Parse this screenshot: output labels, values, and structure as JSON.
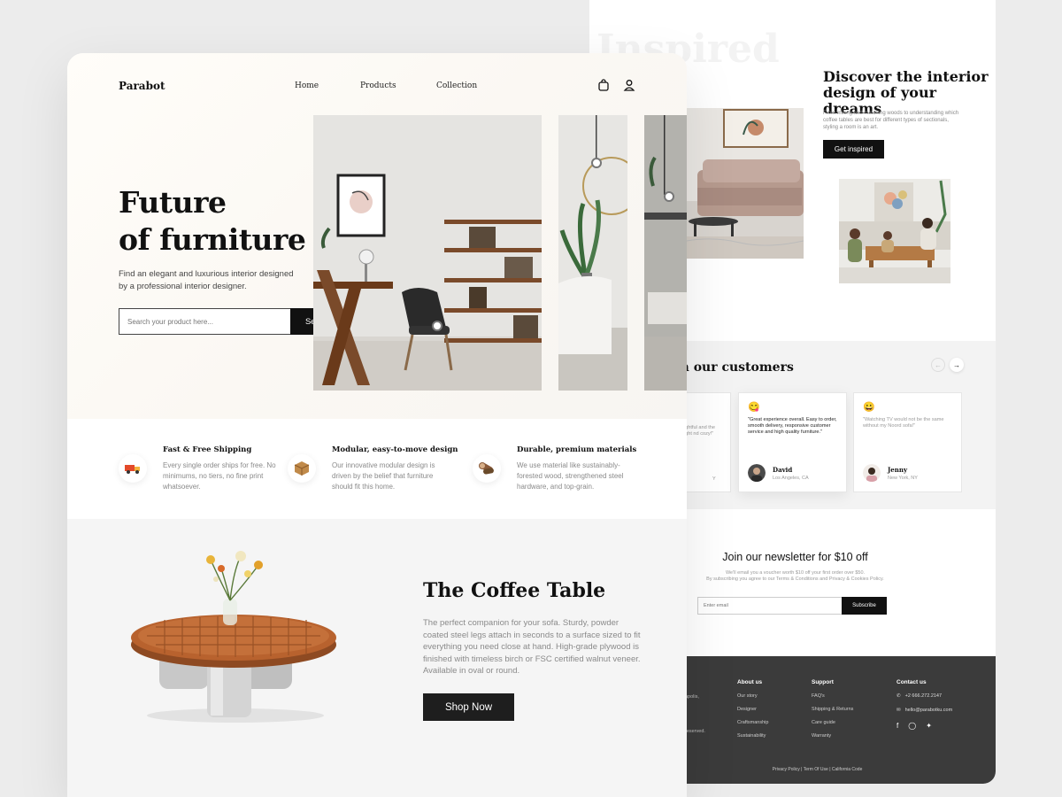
{
  "back": {
    "ghost_text": "Inspired",
    "discover": {
      "title_line1": "Discover the interior",
      "title_line2": "design of your dreams",
      "text": "From mixing and matching woods to understanding which coffee tables are best for different types of sectionals, styling a room is an art.",
      "button": "Get inspired"
    },
    "customers": {
      "title": "m our customers",
      "cards": [
        {
          "quote": "ughtful and the right nd cozy!\"",
          "name": "",
          "location": "Y"
        },
        {
          "quote": "\"Great experience overall. Easy to order, smooth delivery, responsive customer service and high quality furniture.\"",
          "name": "David",
          "location": "Los Angeles, CA"
        },
        {
          "quote": "\"Watching TV would not be the same without my Noord sofa!\"",
          "name": "Jenny",
          "location": "New York, NY"
        }
      ]
    },
    "newsletter": {
      "title": "Join our newsletter for $10 off",
      "sub1": "We'll email you a voucher worth $10 off your first order over $50.",
      "sub2": "By subscribing you agree to our Terms & Conditions and Privacy & Cookies Policy.",
      "placeholder": "Enter email",
      "button": "Subscribe"
    },
    "footer": {
      "partial1": "apolis,",
      "partial2": "reserved.",
      "about": {
        "title": "About us",
        "links": [
          "Our story",
          "Designer",
          "Craftsmanship",
          "Sustainability"
        ]
      },
      "support": {
        "title": "Support",
        "links": [
          "FAQ's",
          "Shipping & Returns",
          "Care guide",
          "Warranty"
        ]
      },
      "contact": {
        "title": "Contact us",
        "phone": "+2 666.272.2147",
        "email": "hello@parabotku.com"
      },
      "legal": "Privacy Policy | Term Of Use | California Code"
    }
  },
  "front": {
    "logo": "Parabot",
    "nav": [
      "Home",
      "Products",
      "Collection"
    ],
    "hero": {
      "title_line1": "Future",
      "title_line2": "of furniture",
      "subtitle": "Find an elegant and luxurious interior designed by a professional interior designer.",
      "search_placeholder": "Search your product here...",
      "search_button": "Search"
    },
    "features": [
      {
        "title": "Fast & Free Shipping",
        "text": "Every single order ships for free. No minimums, no tiers, no fine print whatsoever."
      },
      {
        "title": "Modular, easy-to-move design",
        "text": "Our innovative modular design is driven by the belief that furniture should fit this home."
      },
      {
        "title": "Durable, premium materials",
        "text": "We use material like sustainably-forested wood, strengthened steel hardware, and top-grain."
      }
    ],
    "product": {
      "title": "The Coffee Table",
      "text": "The perfect companion for your sofa. Sturdy, powder coated steel legs attach in seconds to a surface sized to fit everything you need close at hand. High-grade plywood is finished with timeless birch or FSC certified walnut veneer. Available in oval or round.",
      "button": "Shop Now"
    }
  }
}
